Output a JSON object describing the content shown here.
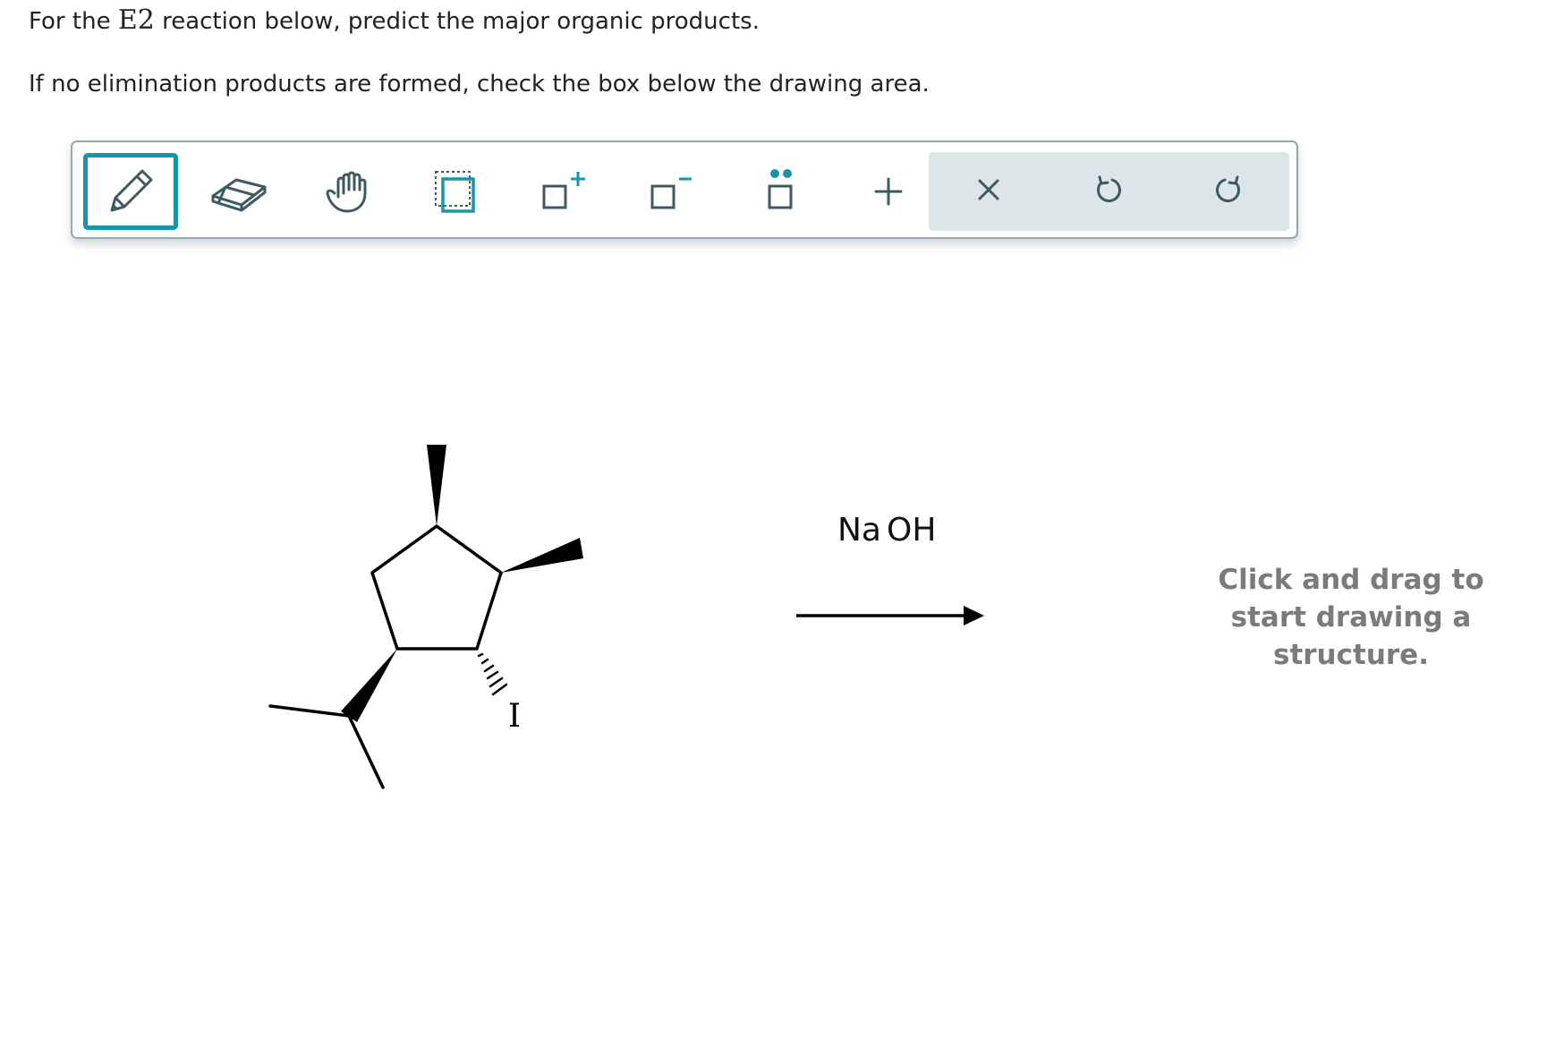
{
  "question": {
    "line1_prefix": "For the ",
    "line1_reaction": "E2",
    "line1_suffix": " reaction below, predict the major organic products.",
    "line2": "If no elimination products are formed, check the box below the drawing area."
  },
  "toolbar": {
    "tools": [
      {
        "name": "pencil-tool",
        "icon": "pencil-icon",
        "active": true
      },
      {
        "name": "eraser-tool",
        "icon": "eraser-icon",
        "active": false
      },
      {
        "name": "hand-tool",
        "icon": "hand-icon",
        "active": false
      },
      {
        "name": "select-tool",
        "icon": "selection-box-icon",
        "active": false
      },
      {
        "name": "positive-charge-tool",
        "icon": "positive-charge-icon",
        "active": false
      },
      {
        "name": "negative-charge-tool",
        "icon": "negative-charge-icon",
        "active": false
      },
      {
        "name": "lone-pair-tool",
        "icon": "lone-pair-icon",
        "active": false
      },
      {
        "name": "add-tool",
        "icon": "plus-icon",
        "active": false
      }
    ],
    "actions": [
      {
        "name": "clear-button",
        "icon": "close-icon"
      },
      {
        "name": "undo-button",
        "icon": "undo-icon"
      },
      {
        "name": "redo-button",
        "icon": "redo-icon"
      }
    ],
    "accent_color": "#1695ad",
    "icon_color": "#3d5a63"
  },
  "reaction": {
    "reagent": "NaOH",
    "reagent_parts": [
      "Na",
      "O",
      "H"
    ],
    "substituent_label": "I",
    "arrow": "right-arrow"
  },
  "drawing_area": {
    "hint": "Click and drag to start drawing a structure."
  }
}
